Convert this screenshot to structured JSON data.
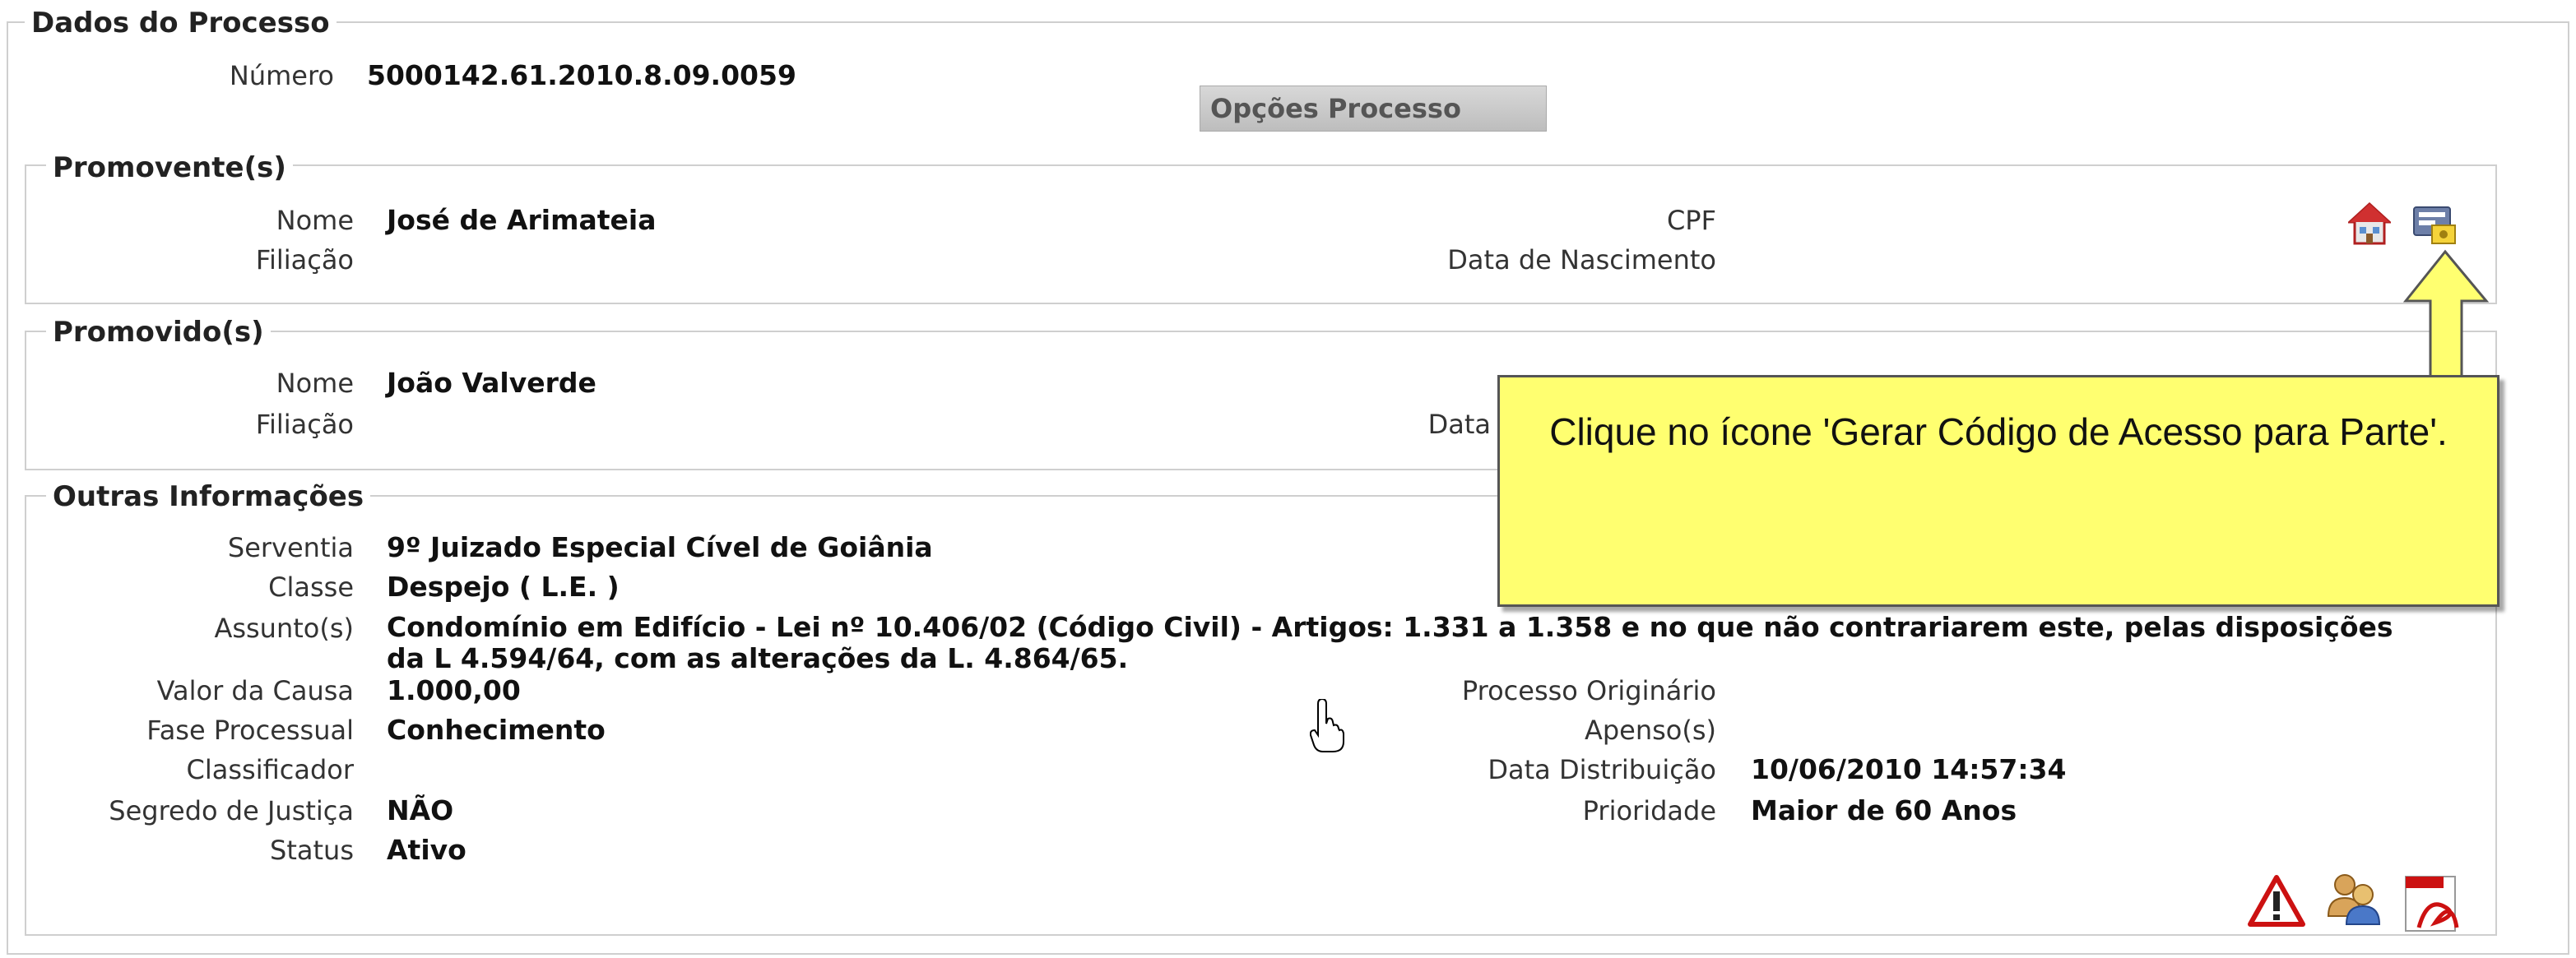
{
  "dados_processo": {
    "legend": "Dados do Processo",
    "numero_label": "Número",
    "numero_value": "5000142.61.2010.8.09.0059",
    "opcoes_button": "Opções Processo"
  },
  "promovente": {
    "legend": "Promovente(s)",
    "nome_label": "Nome",
    "nome_value": "José de Arimateia",
    "filiacao_label": "Filiação",
    "cpf_label": "CPF",
    "data_nasc_label": "Data de Nascimento"
  },
  "promovido": {
    "legend": "Promovido(s)",
    "nome_label": "Nome",
    "nome_value": "João Valverde",
    "filiacao_label": "Filiação",
    "data_label_partial": "Data"
  },
  "outras": {
    "legend": "Outras Informações",
    "serventia_label": "Serventia",
    "serventia_value": "9º Juizado Especial Cível de Goiânia",
    "classe_label": "Classe",
    "classe_value": "Despejo ( L.E. )",
    "assunto_label": "Assunto(s)",
    "assunto_value": "Condomínio em Edifício - Lei nº 10.406/02 (Código Civil) - Artigos: 1.331 a 1.358 e no que não contrariarem este, pelas disposições da L 4.594/64, com as alterações da L. 4.864/65.",
    "valor_label": "Valor da Causa",
    "valor_value": "1.000,00",
    "fase_label": "Fase Processual",
    "fase_value": "Conhecimento",
    "classificador_label": "Classificador",
    "segredo_label": "Segredo de Justiça",
    "segredo_value": "NÃO",
    "status_label": "Status",
    "status_value": "Ativo",
    "proc_orig_label": "Processo Originário",
    "apenso_label": "Apenso(s)",
    "data_dist_label": "Data Distribuição",
    "data_dist_value": "10/06/2010 14:57:34",
    "prioridade_label": "Prioridade",
    "prioridade_value": "Maior de 60 Anos"
  },
  "callout": {
    "text": "Clique no ícone 'Gerar Código de Acesso para Parte'."
  },
  "icons": {
    "address": "home-icon",
    "access_code": "access-code-icon",
    "warning": "warning-icon",
    "parties": "parties-icon",
    "pdf": "pdf-icon"
  },
  "colors": {
    "callout_bg": "#ffff70",
    "border": "#cfcfcf",
    "warning_red": "#cc1111"
  }
}
